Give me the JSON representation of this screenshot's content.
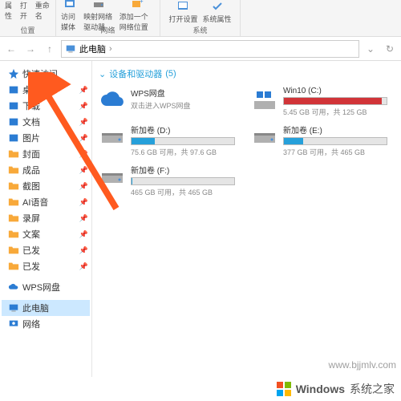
{
  "ribbon": {
    "groups": [
      {
        "label": "位置",
        "items": [
          {
            "t": "属性"
          },
          {
            "t": "打开"
          },
          {
            "t": "重命名"
          }
        ]
      },
      {
        "label": "网络",
        "items": [
          {
            "t": "访问媒体"
          },
          {
            "t": "映射网络驱动器"
          },
          {
            "t": "添加一个网络位置"
          }
        ]
      },
      {
        "label": "系统",
        "items": [
          {
            "t": "打开设置"
          },
          {
            "t": "系统属性"
          }
        ]
      }
    ]
  },
  "breadcrumb": {
    "root": "此电脑",
    "sep": "›"
  },
  "sidebar": {
    "items": [
      {
        "t": "快速访问",
        "icon": "star",
        "color": "#2b7cd3"
      },
      {
        "t": "桌面",
        "icon": "desktop",
        "color": "#2b7cd3",
        "pin": true
      },
      {
        "t": "下载",
        "icon": "download",
        "color": "#2b7cd3",
        "pin": true
      },
      {
        "t": "文档",
        "icon": "doc",
        "color": "#2b7cd3",
        "pin": true
      },
      {
        "t": "图片",
        "icon": "pic",
        "color": "#2b7cd3",
        "pin": true
      },
      {
        "t": "封面",
        "icon": "folder",
        "color": "#f8a93a",
        "pin": true
      },
      {
        "t": "成品",
        "icon": "folder",
        "color": "#f8a93a",
        "pin": true
      },
      {
        "t": "截图",
        "icon": "folder",
        "color": "#f8a93a",
        "pin": true
      },
      {
        "t": "AI语音",
        "icon": "folder",
        "color": "#f8a93a",
        "pin": true
      },
      {
        "t": "录屏",
        "icon": "folder",
        "color": "#f8a93a",
        "pin": true
      },
      {
        "t": "文案",
        "icon": "folder",
        "color": "#f8a93a",
        "pin": true
      },
      {
        "t": "已发",
        "icon": "folder",
        "color": "#f8a93a",
        "pin": true
      },
      {
        "t": "已发",
        "icon": "folder",
        "color": "#f8a93a",
        "pin": true
      },
      {
        "t": "",
        "spacer": true
      },
      {
        "t": "WPS网盘",
        "icon": "cloud",
        "color": "#2b7cd3"
      },
      {
        "t": "",
        "spacer": true
      },
      {
        "t": "此电脑",
        "icon": "pc",
        "color": "#2b7cd3",
        "active": true
      },
      {
        "t": "网络",
        "icon": "net",
        "color": "#2b7cd3"
      }
    ]
  },
  "section": {
    "title": "设备和驱动器",
    "count": "(5)"
  },
  "drives": [
    {
      "name": "WPS网盘",
      "sub": "双击进入WPS网盘",
      "type": "cloud"
    },
    {
      "name": "Win10 (C:)",
      "stats": "5.45 GB 可用，共 125 GB",
      "fill": 95,
      "red": true,
      "type": "os"
    },
    {
      "name": "新加卷 (D:)",
      "stats": "75.6 GB 可用，共 97.6 GB",
      "fill": 23,
      "type": "hdd"
    },
    {
      "name": "新加卷 (E:)",
      "stats": "377 GB 可用，共 465 GB",
      "fill": 19,
      "type": "hdd"
    },
    {
      "name": "新加卷 (F:)",
      "stats": "465 GB 可用，共 465 GB",
      "fill": 1,
      "type": "hdd"
    }
  ],
  "watermark": "www.bjjmlv.com",
  "footer": {
    "brand": "Windows",
    "tag": "系统之家"
  }
}
